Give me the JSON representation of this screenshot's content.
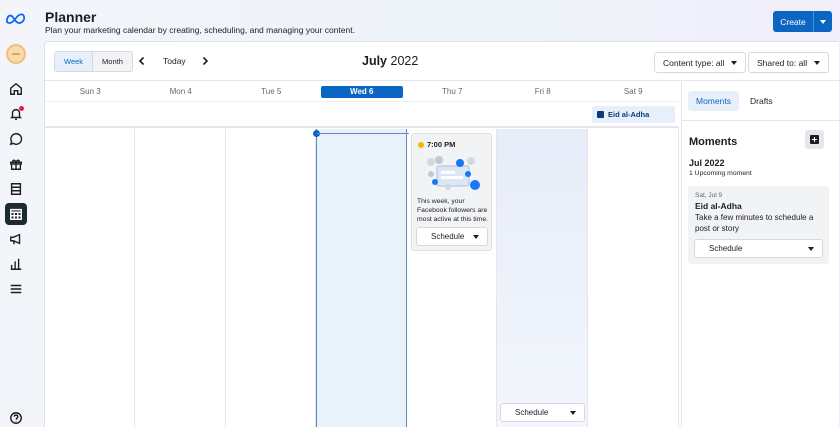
{
  "header": {
    "title": "Planner",
    "subtitle": "Plan your marketing calendar by creating, scheduling, and managing your content.",
    "create_label": "Create"
  },
  "nav": {
    "icons": [
      "meta-logo",
      "avatar",
      "home-icon",
      "notifications-icon",
      "messages-icon",
      "gift-icon",
      "content-library-icon",
      "planner-icon",
      "ads-icon",
      "insights-icon",
      "menu-icon",
      "help-icon"
    ],
    "active": "planner-icon"
  },
  "toolbar": {
    "week_label": "Week",
    "month_label": "Month",
    "today_label": "Today",
    "month_name": "July",
    "year": "2022",
    "content_filter": "Content type: all",
    "shared_filter": "Shared to: all"
  },
  "days": [
    {
      "label": "Sun 3"
    },
    {
      "label": "Mon 4"
    },
    {
      "label": "Tue 5"
    },
    {
      "label": "Wed 6"
    },
    {
      "label": "Thu 7"
    },
    {
      "label": "Fri 8"
    },
    {
      "label": "Sat 9"
    }
  ],
  "allday_event": "Eid al-Adha",
  "recommendation": {
    "time": "7:00 PM",
    "message": "This week, your Facebook followers are most active at this time.",
    "schedule_label": "Schedule"
  },
  "fri_schedule_label": "Schedule",
  "side": {
    "tab_moments": "Moments",
    "tab_drafts": "Drafts",
    "heading": "Moments",
    "month": "Jul 2022",
    "count": "1 Upcoming moment",
    "card": {
      "date": "Sat, Jul 9",
      "name": "Eid al-Adha",
      "text": "Take a few minutes to schedule a post or story",
      "schedule_label": "Schedule"
    }
  },
  "colors": {
    "accent": "#0a66c2",
    "active_nav": "#1c2b33",
    "today_column": "#e9f1fa"
  }
}
